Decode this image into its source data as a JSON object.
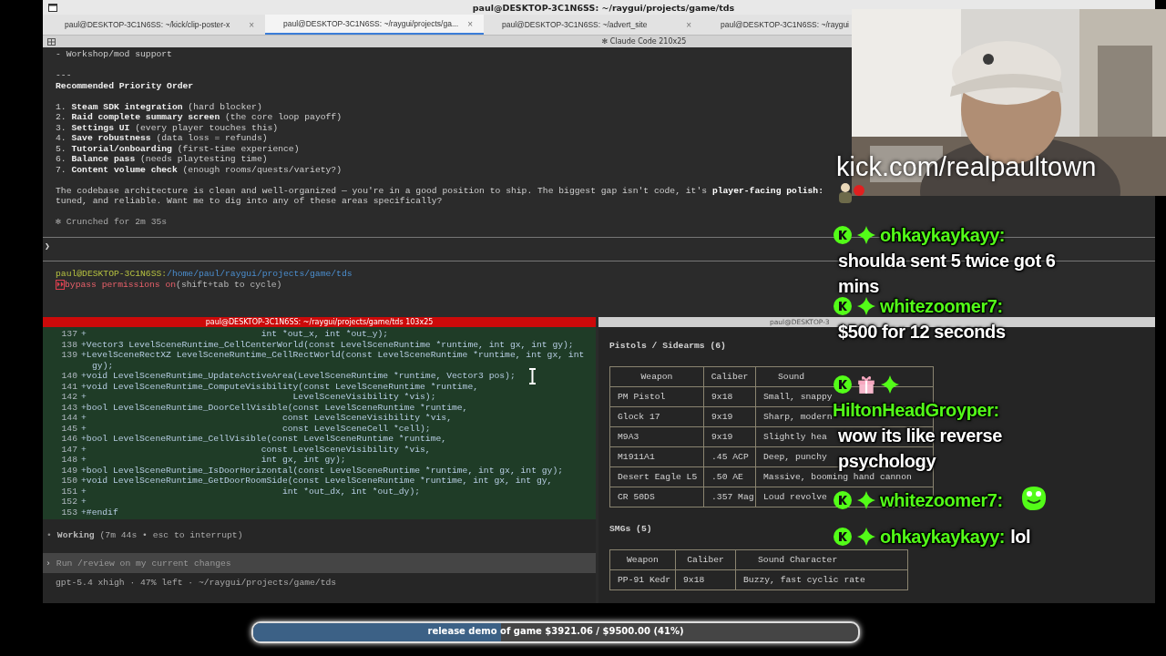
{
  "window": {
    "title": "paul@DESKTOP-3C1N6SS: ~/raygui/projects/game/tds"
  },
  "tabs": [
    {
      "label": "paul@DESKTOP-3C1N6SS: ~/kick/clip-poster-x",
      "close": "×",
      "selected": false
    },
    {
      "label": "paul@DESKTOP-3C1N6SS: ~/raygui/projects/ga...",
      "close": "×",
      "selected": true
    },
    {
      "label": "paul@DESKTOP-3C1N6SS: ~/advert_site",
      "close": "×",
      "selected": false
    },
    {
      "label": "paul@DESKTOP-3C1N6SS: ~/raygui",
      "selected": false
    }
  ],
  "pane_title": "✻ Claude Code 210x25",
  "top_pane": {
    "intro": "- Workshop/mod support",
    "rule": "---",
    "heading": "Recommended Priority Order",
    "priorities": [
      {
        "num": "1.",
        "title": "Steam SDK integration",
        "note": "(hard blocker)"
      },
      {
        "num": "2.",
        "title": "Raid complete summary screen",
        "note": "(the core loop payoff)"
      },
      {
        "num": "3.",
        "title": "Settings UI",
        "note": "(every player touches this)"
      },
      {
        "num": "4.",
        "title": "Save robustness",
        "note": "(data loss = refunds)"
      },
      {
        "num": "5.",
        "title": "Tutorial/onboarding",
        "note": "(first-time experience)"
      },
      {
        "num": "6.",
        "title": "Balance pass",
        "note": "(needs playtesting time)"
      },
      {
        "num": "7.",
        "title": "Content volume check",
        "note": "(enough rooms/quests/variety?)"
      }
    ],
    "summary": [
      "The codebase architecture is clean and well-organized — you're in a good position to ship. The biggest gap isn't code, it's **player-facing polish:**",
      "tuned, and reliable. Want me to dig into any of these areas specifically?"
    ],
    "status": "✻ Crunched for 2m 35s",
    "prompt_char": "❯",
    "shell": {
      "user": "paul@DESKTOP-3C1N6SS:",
      "path": "/home/paul/raygui/projects/game/tds"
    },
    "mode": {
      "icon": "⏵⏵",
      "label": "bypass permissions on",
      "hint": "(shift+tab to cycle)"
    }
  },
  "left_pane": {
    "title": "paul@DESKTOP-3C1N6SS: ~/raygui/projects/game/tds 103x25",
    "code": [
      {
        "num": "137",
        "text": "+                                 int *out_x, int *out_y);"
      },
      {
        "num": "138",
        "text": "+Vector3 LevelSceneRuntime_CellCenterWorld(const LevelSceneRuntime *runtime, int gx, int gy);"
      },
      {
        "num": "139",
        "text": "+LevelSceneRectXZ LevelSceneRuntime_CellRectWorld(const LevelSceneRuntime *runtime, int gx, int",
        "continuation": "gy);"
      },
      {
        "num": "140",
        "text": "+void LevelSceneRuntime_UpdateActiveArea(LevelSceneRuntime *runtime, Vector3 pos);"
      },
      {
        "num": "141",
        "text": "+void LevelSceneRuntime_ComputeVisibility(const LevelSceneRuntime *runtime,"
      },
      {
        "num": "142",
        "text": "+                                       LevelSceneVisibility *vis);"
      },
      {
        "num": "143",
        "text": "+bool LevelSceneRuntime_DoorCellVisible(const LevelSceneRuntime *runtime,"
      },
      {
        "num": "144",
        "text": "+                                     const LevelSceneVisibility *vis,"
      },
      {
        "num": "145",
        "text": "+                                     const LevelSceneCell *cell);"
      },
      {
        "num": "146",
        "text": "+bool LevelSceneRuntime_CellVisible(const LevelSceneRuntime *runtime,"
      },
      {
        "num": "147",
        "text": "+                                 const LevelSceneVisibility *vis,"
      },
      {
        "num": "148",
        "text": "+                                 int gx, int gy);"
      },
      {
        "num": "149",
        "text": "+bool LevelSceneRuntime_IsDoorHorizontal(const LevelSceneRuntime *runtime, int gx, int gy);"
      },
      {
        "num": "150",
        "text": "+void LevelSceneRuntime_GetDoorRoomSide(const LevelSceneRuntime *runtime, int gx, int gy,"
      },
      {
        "num": "151",
        "text": "+                                     int *out_dx, int *out_dy);"
      },
      {
        "num": "152",
        "text": "+"
      },
      {
        "num": "153",
        "text": "+#endif"
      }
    ],
    "status": {
      "bullet": "•",
      "label": "Working",
      "detail": "(7m 44s • esc to interrupt)"
    },
    "input": {
      "prompt": "›",
      "placeholder": "Run /review on my current changes"
    },
    "footer": "gpt-5.4 xhigh · 47% left · ~/raygui/projects/game/tds"
  },
  "right_pane": {
    "title": "paul@DESKTOP-3",
    "sections": [
      {
        "title": "Pistols / Sidearms (6)",
        "columns": [
          "Weapon",
          "Caliber",
          "Sound"
        ],
        "rows": [
          [
            "PM Pistol",
            "9x18",
            "Small, snappy"
          ],
          [
            "Glock 17",
            "9x19",
            "Sharp, modern"
          ],
          [
            "M9A3",
            "9x19",
            "Slightly hea"
          ],
          [
            "M1911A1",
            ".45 ACP",
            "Deep, punchy"
          ],
          [
            "Desert Eagle L5",
            ".50 AE",
            "Massive, booming hand cannon"
          ],
          [
            "CR 50DS",
            ".357 Mag",
            "Loud revolve"
          ]
        ]
      },
      {
        "title": "SMGs (5)",
        "columns": [
          "Weapon",
          "Caliber",
          "Sound Character"
        ],
        "rows": [
          [
            "PP-91 Kedr",
            "9x18",
            "Buzzy, fast cyclic rate"
          ]
        ]
      }
    ]
  },
  "webcam": {
    "kind": "picture",
    "caption": "kick.com/realpaultown"
  },
  "chat": [
    {
      "user": "ohkaykaykayy:",
      "text": "shoulda sent 5 twice got 6 mins",
      "gifter": false,
      "kind": "text"
    },
    {
      "user": "whitezoomer7:",
      "text": "$500 for 12 seconds",
      "gifter": false,
      "kind": "text"
    },
    {
      "user": "HiltonHeadGroyper:",
      "text": "wow its like reverse psychology",
      "gifter": true,
      "kind": "text"
    },
    {
      "user": "whitezoomer7:",
      "gifter": false,
      "kind": "emote"
    },
    {
      "user": "ohkaykaykayy:",
      "text": "lol",
      "gifter": false,
      "kind": "text"
    }
  ],
  "goal": {
    "text": "release demo of game $3921.06 / $9500.00 (41%)",
    "level": 0.41
  }
}
